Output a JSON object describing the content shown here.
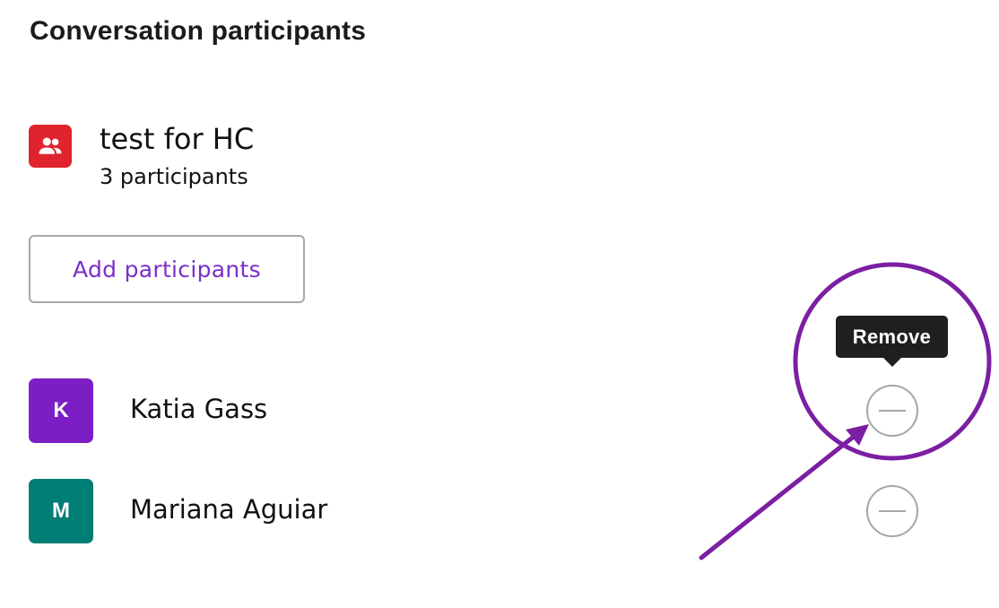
{
  "header": {
    "title": "Conversation participants"
  },
  "group": {
    "icon": "group-icon",
    "icon_color": "#e0242f",
    "name": "test for HC",
    "participant_count_text": "3 participants"
  },
  "add_button": {
    "label": "Add participants",
    "color": "#7b2fc9"
  },
  "participants": [
    {
      "initial": "K",
      "name": "Katia Gass",
      "avatar_color": "#7b1fc4"
    },
    {
      "initial": "M",
      "name": "Mariana Aguiar",
      "avatar_color": "#007d74"
    }
  ],
  "tooltip": {
    "text": "Remove"
  },
  "annotation": {
    "color": "#7b1fa2",
    "icons": [
      "highlight-circle",
      "arrow"
    ]
  }
}
